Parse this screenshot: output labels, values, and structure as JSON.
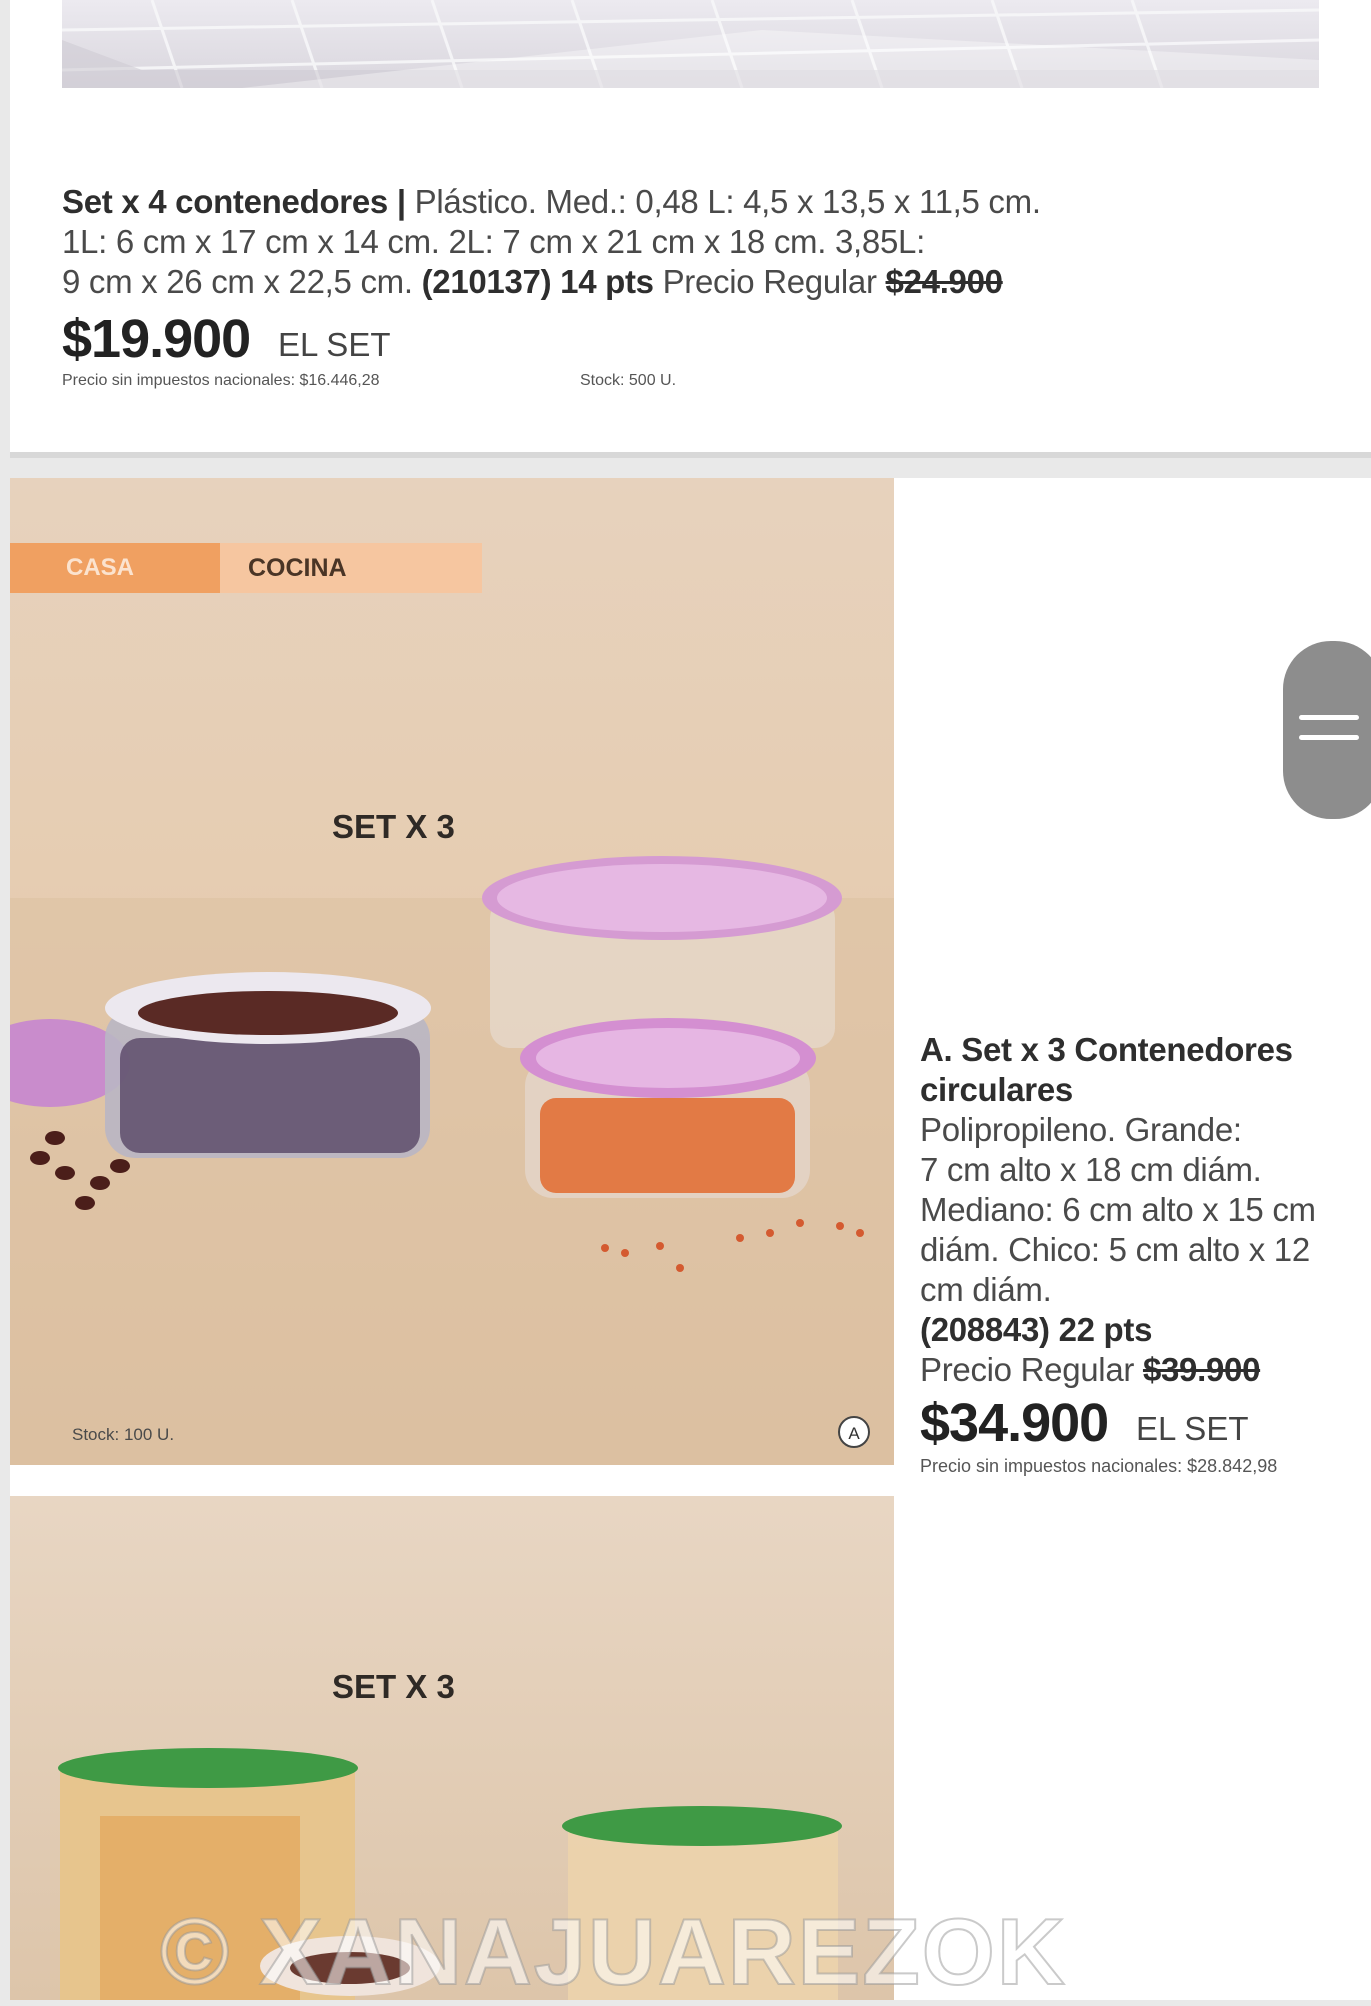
{
  "product1": {
    "name": "Set x 4 contenedores |",
    "desc_line1": " Plástico. Med.: 0,48 L: 4,5 x 13,5 x 11,5 cm.",
    "desc_line2": "1L: 6 cm x 17 cm x 14 cm. 2L: 7 cm x 21 cm x 18 cm. 3,85L:",
    "desc_line3": "9 cm x 26 cm x 22,5 cm. ",
    "code_pts": "(210137) 14 pts",
    "regular_label": " Precio Regular ",
    "regular_price": "$24.900",
    "price": "$19.900",
    "unit": "EL SET",
    "tax_note": "Precio sin impuestos nacionales: $16.446,28",
    "stock": "Stock: 500 U."
  },
  "category_tabs": {
    "active": "CASA",
    "current": "COCINA"
  },
  "photo2": {
    "heading": "SET X 3",
    "stock": "Stock: 100 U.",
    "marker": "A"
  },
  "product2": {
    "title_line1": "A. Set x 3 Contenedores",
    "title_line2": "circulares",
    "desc_line1": "Polipropileno. Grande:",
    "desc_line2": "7 cm alto x 18 cm diám.",
    "desc_line3": "Mediano: 6 cm alto x 15 cm",
    "desc_line4": "diám. Chico: 5 cm alto x 12",
    "desc_line5": "cm diám.",
    "code_pts": "(208843) 22 pts",
    "regular_label": "Precio Regular ",
    "regular_price": "$39.900",
    "price": "$34.900",
    "unit": "EL SET",
    "tax_note": "Precio sin impuestos nacionales: $28.842,98"
  },
  "photo3": {
    "heading": "SET X 3"
  },
  "watermark": "© XANAJUAREZOK",
  "colors": {
    "tab_active": "#f0a061",
    "tab_current": "#f6c6a0",
    "lid_pink": "#c77bc9",
    "lid_green": "#3f9a45"
  },
  "icons": {
    "menu": "hamburger-menu-icon",
    "marker": "circled-letter-marker"
  }
}
